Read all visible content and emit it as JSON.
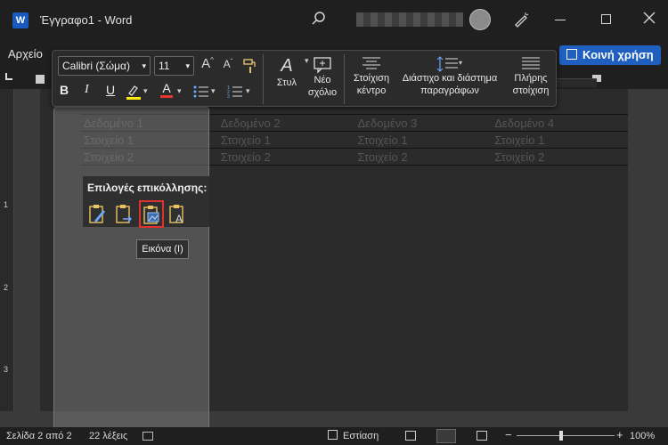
{
  "window": {
    "title": "Έγγραφο1  -  Word",
    "app_icon": "W"
  },
  "menu": {
    "file": "Αρχείο",
    "share_label": "Κοινή χρήση"
  },
  "ribbon": {
    "font_name": "Calibri (Σώμα)",
    "font_size": "11",
    "styles_label": "Στυλ",
    "new_comment_label": "Νέο\nσχόλιο",
    "center_label": "Στοίχιση\nκέντρο",
    "spacing_label": "Διάστιχο και διάστημα\nπαραγράφων",
    "justify_label": "Πλήρης\nστοίχιση",
    "bold": "B",
    "italic": "I",
    "underline": "U",
    "font_color_letter": "A"
  },
  "table": {
    "rows": [
      [
        "Δεδομένο 1",
        "Δεδομένο 2",
        "Δεδομένο 3",
        "Δεδομένο 4"
      ],
      [
        "Στοιχείο 1",
        "Στοιχείο 1",
        "Στοιχείο 1",
        "Στοιχείο 1"
      ],
      [
        "Στοιχείο 2",
        "Στοιχείο 2",
        "Στοιχείο 2",
        "Στοιχείο 2"
      ]
    ]
  },
  "paste_options": {
    "title": "Επιλογές επικόλλησης:",
    "tooltip": "Εικόνα (I)"
  },
  "ruler_numbers": [
    "1",
    "1",
    "2",
    "3"
  ],
  "status": {
    "page": "Σελίδα 2 από 2",
    "words": "22 λέξεις",
    "focus": "Εστίαση",
    "zoom": "100%"
  },
  "colors": {
    "highlight": "#ffeb00",
    "font_color": "#e8372f",
    "share_bg": "#1f5fbf"
  }
}
